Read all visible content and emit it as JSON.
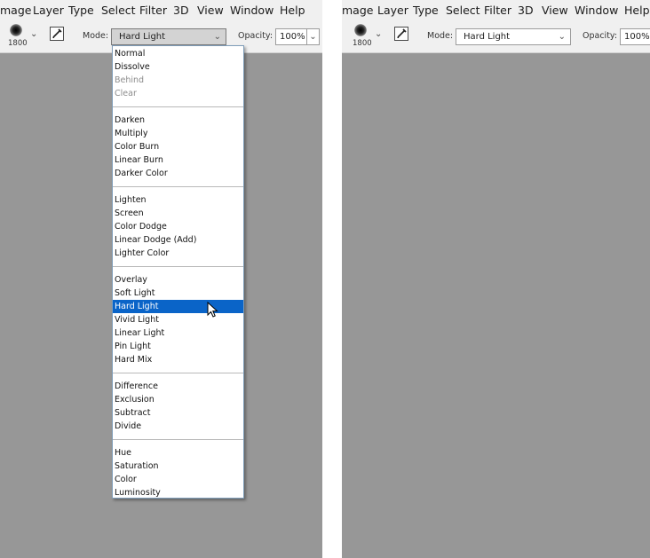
{
  "menubar": {
    "items": [
      "mage",
      "Layer",
      "Type",
      "Select",
      "Filter",
      "3D",
      "View",
      "Window",
      "Help"
    ]
  },
  "options_bar": {
    "brush_size": "1800",
    "mode_label": "Mode:",
    "mode_value": "Hard Light",
    "opacity_label": "Opacity:",
    "opacity_value": "100%"
  },
  "blend_menu": {
    "selected": "Hard Light",
    "groups": [
      [
        "Normal",
        "Dissolve",
        "Behind",
        "Clear"
      ],
      [
        "Darken",
        "Multiply",
        "Color Burn",
        "Linear Burn",
        "Darker Color"
      ],
      [
        "Lighten",
        "Screen",
        "Color Dodge",
        "Linear Dodge (Add)",
        "Lighter Color"
      ],
      [
        "Overlay",
        "Soft Light",
        "Hard Light",
        "Vivid Light",
        "Linear Light",
        "Pin Light",
        "Hard Mix"
      ],
      [
        "Difference",
        "Exclusion",
        "Subtract",
        "Divide"
      ],
      [
        "Hue",
        "Saturation",
        "Color",
        "Luminosity"
      ]
    ],
    "disabled": [
      "Behind",
      "Clear"
    ]
  },
  "colors": {
    "canvas": "#979797",
    "menubar": "#f0f0f0",
    "selection": "#0a64c8"
  }
}
